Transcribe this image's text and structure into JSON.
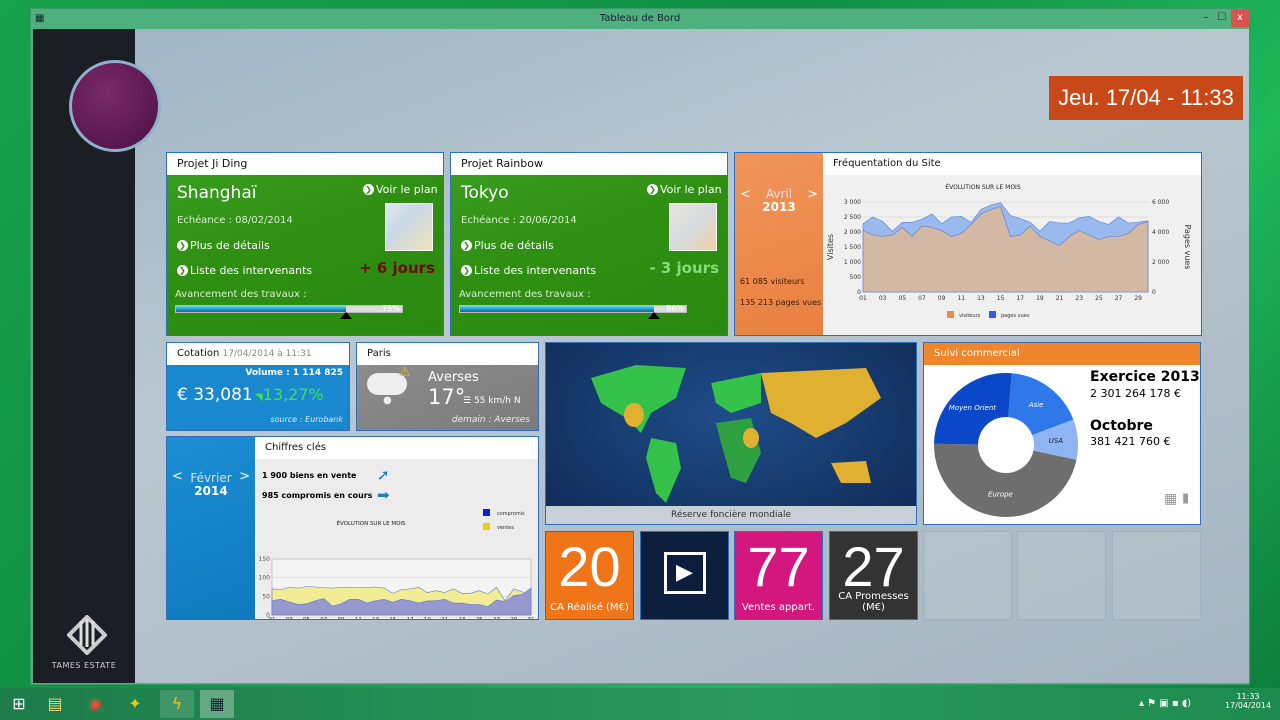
{
  "window": {
    "title": "Tableau de Bord",
    "minimize": "–",
    "maximize": "☐",
    "close": "x"
  },
  "datetime": "Jeu. 17/04 - 11:33",
  "brand": "TAMES ESTATE",
  "projects": [
    {
      "title": "Projet Ji Ding",
      "city": "Shanghaï",
      "see_plan": "Voir le plan",
      "deadline": "Echéance : 08/02/2014",
      "details": "Plus de détails",
      "contributors": "Liste des intervenants",
      "delay": "+ 6 jours",
      "delay_color": "#6b0d0d",
      "progress_label": "Avancement des travaux :",
      "progress": 75,
      "progress_text": "75%"
    },
    {
      "title": "Projet Rainbow",
      "city": "Tokyo",
      "see_plan": "Voir le plan",
      "deadline": "Echéance : 20/06/2014",
      "details": "Plus de détails",
      "contributors": "Liste des intervenants",
      "delay": "- 3 jours",
      "delay_color": "#7fe07a",
      "progress_label": "Avancement des travaux :",
      "progress": 86,
      "progress_text": "86%"
    }
  ],
  "traffic": {
    "title": "Fréquentation du Site",
    "prev": "<",
    "next": ">",
    "month": "Avril",
    "year": "2013",
    "visitors": "61 085 visiteurs",
    "pageviews": "135 213 pages vues"
  },
  "quote": {
    "title": "Cotation",
    "time": "17/04/2014 à 11:31",
    "volume": "Volume : 1 114 825",
    "price": "€ 33,081",
    "change": "13,27%",
    "source": "source : Eurobank"
  },
  "weather": {
    "city": "Paris",
    "condition": "Averses",
    "temp": "17°",
    "wind": "55 km/h N",
    "tomorrow": "demain : Averses"
  },
  "keyfigures": {
    "title": "Chiffres clés",
    "prev": "<",
    "next": ">",
    "month": "Février",
    "year": "2014",
    "line1": "1 900 biens en vente",
    "line2": "985 compromis en cours"
  },
  "map": {
    "caption": "Réserve foncière mondiale"
  },
  "sales": {
    "title": "Suivi commercial",
    "label1": "Exercice 2013",
    "value1": "2 301 264 178 €",
    "label2": "Octobre",
    "value2": "381 421 760 €"
  },
  "kpis": [
    {
      "value": "20",
      "label": "CA Réalisé (M€)",
      "color": "#f07418"
    },
    {
      "value": "77",
      "label": "Ventes appart.",
      "color": "#d4167f"
    },
    {
      "value": "27",
      "label": "CA Promesses (M€)",
      "color": "#333"
    }
  ],
  "taskbar": {
    "time": "11:33",
    "date": "17/04/2014"
  },
  "chart_data": [
    {
      "type": "area",
      "title": "ÉVOLUTION SUR LE MOIS",
      "ylabel": "Visites",
      "y2label": "Pages vues",
      "ylim": [
        0,
        3000
      ],
      "y2lim": [
        0,
        6000
      ],
      "yticks": [
        "3 000",
        "2 500",
        "2 000",
        "1 500",
        "1 000",
        "500",
        "0"
      ],
      "y2ticks": [
        "6 000",
        "4 000",
        "2 000",
        "0"
      ],
      "xticks": [
        "01",
        "03",
        "05",
        "07",
        "09",
        "11",
        "13",
        "15",
        "17",
        "19",
        "21",
        "23",
        "25",
        "27",
        "29"
      ],
      "legend": [
        "visiteurs",
        "pages vues"
      ],
      "series": [
        {
          "name": "visiteurs",
          "axis": "left",
          "color": "#d9b89a",
          "values": [
            2050,
            1900,
            1850,
            1900,
            2150,
            1850,
            2200,
            2150,
            2050,
            1850,
            1950,
            2250,
            2600,
            2750,
            2850,
            1850,
            1900,
            2200,
            1850,
            1700,
            1550,
            1850,
            2050,
            1900,
            1750,
            1850,
            1850,
            1950,
            2250,
            2350
          ]
        },
        {
          "name": "pages vues",
          "axis": "right",
          "color": "#8fb3ee",
          "values": [
            4550,
            5000,
            4700,
            4050,
            4650,
            4650,
            4850,
            5200,
            4550,
            5000,
            5050,
            4650,
            5500,
            5800,
            5950,
            5100,
            4900,
            4650,
            4050,
            4700,
            4600,
            4600,
            4950,
            5050,
            4700,
            4500,
            5000,
            4600,
            4650,
            4750
          ]
        }
      ]
    },
    {
      "type": "area",
      "title": "ÉVOLUTION SUR LE MOIS",
      "ylim": [
        0,
        150
      ],
      "yticks": [
        "150",
        "100",
        "50",
        "0"
      ],
      "xticks": [
        "01",
        "03",
        "05",
        "07",
        "09",
        "11",
        "13",
        "15",
        "17",
        "19",
        "21",
        "23",
        "25",
        "27",
        "29",
        "31"
      ],
      "legend": [
        "compromis",
        "ventes"
      ],
      "series": [
        {
          "name": "ventes",
          "color": "#f2ec8a",
          "values": [
            70,
            68,
            74,
            72,
            76,
            75,
            73,
            72,
            74,
            74,
            73,
            74,
            75,
            72,
            58,
            68,
            70,
            74,
            60,
            65,
            60,
            70,
            58,
            58,
            65,
            56,
            74,
            38,
            70,
            62,
            40
          ]
        },
        {
          "name": "compromis",
          "color": "#8e8ed6",
          "values": [
            38,
            42,
            35,
            28,
            30,
            38,
            44,
            24,
            30,
            42,
            42,
            32,
            38,
            42,
            34,
            42,
            38,
            32,
            38,
            38,
            42,
            32,
            32,
            28,
            28,
            22,
            40,
            36,
            52,
            55,
            72
          ]
        }
      ]
    },
    {
      "type": "pie",
      "slices": [
        {
          "label": "Asie",
          "value": 18,
          "color": "#2f78ea"
        },
        {
          "label": "USA",
          "value": 9,
          "color": "#8fb4f2"
        },
        {
          "label": "Europe",
          "value": 47,
          "color": "#6e6e6e"
        },
        {
          "label": "Moyen Orient",
          "value": 26,
          "color": "#0a47c9"
        }
      ]
    }
  ]
}
